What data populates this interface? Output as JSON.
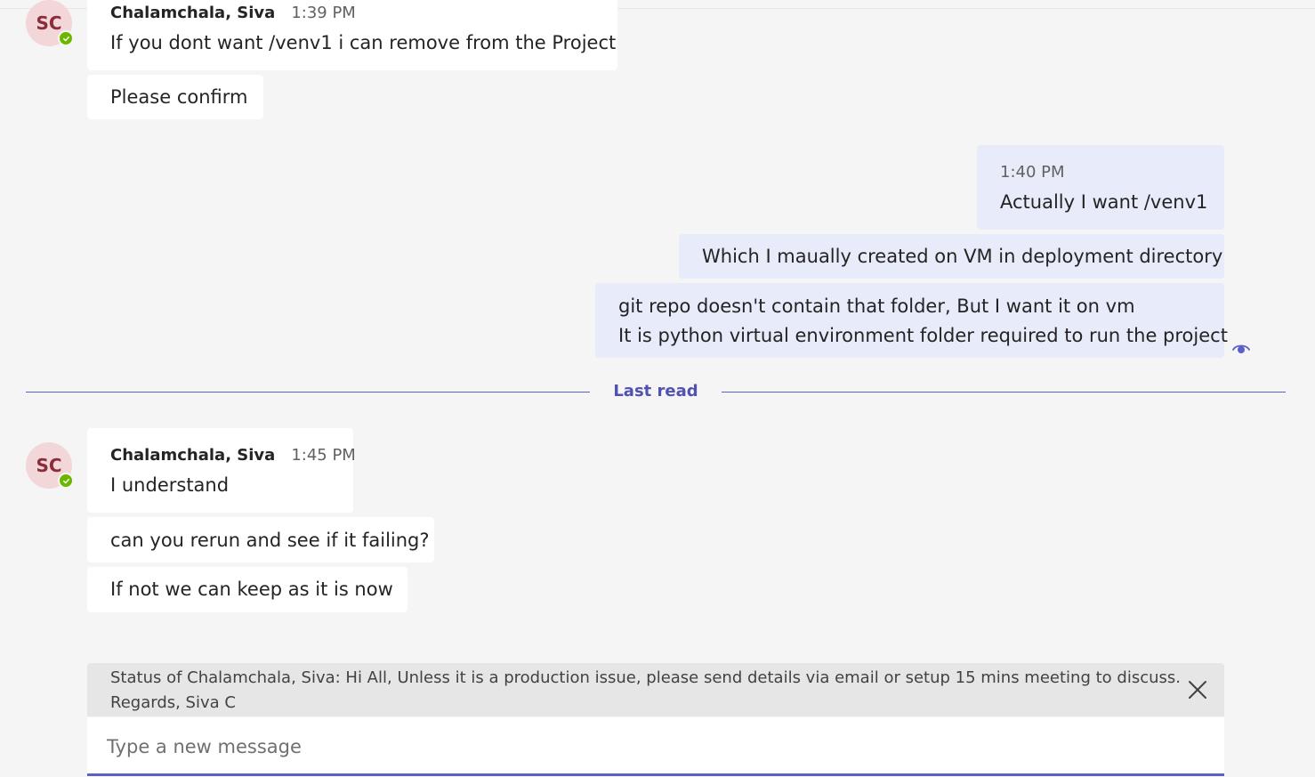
{
  "top_group": {
    "author": "Chalamchala, Siva",
    "time": "1:39 PM",
    "avatar_initials": "SC",
    "messages": [
      "If you dont want /venv1 i can remove from the Project",
      "Please confirm"
    ]
  },
  "my_group": {
    "time": "1:40 PM",
    "messages": [
      "Actually I want /venv1",
      "Which I maually created on VM in deployment directory",
      "git repo doesn't contain that folder, But I want it on vm",
      "It is python virtual environment folder required to run the project"
    ]
  },
  "divider": {
    "label": "Last read"
  },
  "bottom_group": {
    "author": "Chalamchala, Siva",
    "time": "1:45 PM",
    "avatar_initials": "SC",
    "messages": [
      "I understand",
      "can you rerun and see if it failing?",
      "If not we can keep as it is now"
    ]
  },
  "status_banner": {
    "line1": "Status of Chalamchala, Siva: Hi All, Unless it is a production issue, please send details via email or setup 15 mins meeting to discuss.",
    "line2": "Regards, Siva C"
  },
  "composer": {
    "placeholder": "Type a new message"
  },
  "colors": {
    "accent": "#5b5fc7",
    "my_bubble": "#e8ebfa",
    "presence_available": "#6bb700"
  },
  "icons": {
    "presence": "check-icon",
    "read_receipt": "eye-icon",
    "close": "close-icon"
  }
}
